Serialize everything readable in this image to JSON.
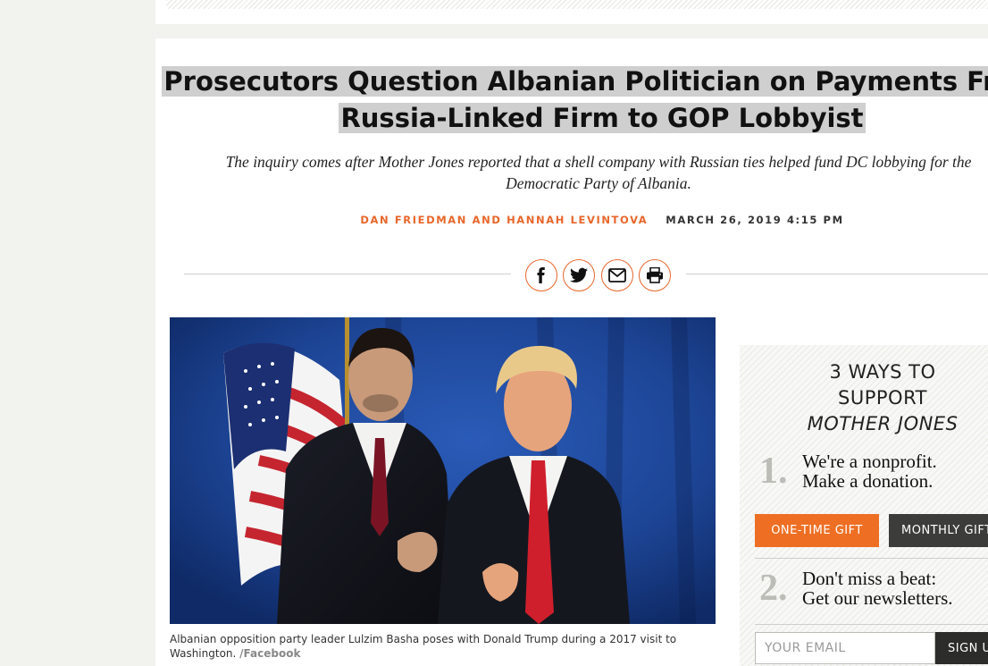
{
  "article": {
    "headline": "Prosecutors Question Albanian Politician on Payments From Russia-Linked Firm to GOP Lobbyist",
    "dek": "The inquiry comes after Mother Jones reported that a shell company with Russian ties helped fund DC lobbying for the Democratic Party of Albania.",
    "authors": "Dan Friedman and Hannah Levintova",
    "date": "March 26, 2019 4:15 PM",
    "caption": "Albanian opposition party leader Lulzim Basha poses with Donald Trump during a 2017 visit to Washington.",
    "credit": "/Facebook"
  },
  "share": {
    "icons": [
      "facebook-icon",
      "twitter-icon",
      "email-icon",
      "print-icon"
    ],
    "accent": "#e8662b"
  },
  "support": {
    "title_line1": "3 WAYS TO",
    "title_line2": "SUPPORT",
    "brand": "MOTHER JONES",
    "step1_num": "1.",
    "step1_line1": "We're a nonprofit.",
    "step1_line2": "Make a donation.",
    "one_time": "ONE-TIME GIFT",
    "monthly": "MONTHLY GIFT",
    "step2_num": "2.",
    "step2_line1": "Don't miss a beat:",
    "step2_line2": "Get our newsletters.",
    "email_placeholder": "YOUR EMAIL",
    "signup": "SIGN UP",
    "button_color": "#ee6f24"
  }
}
